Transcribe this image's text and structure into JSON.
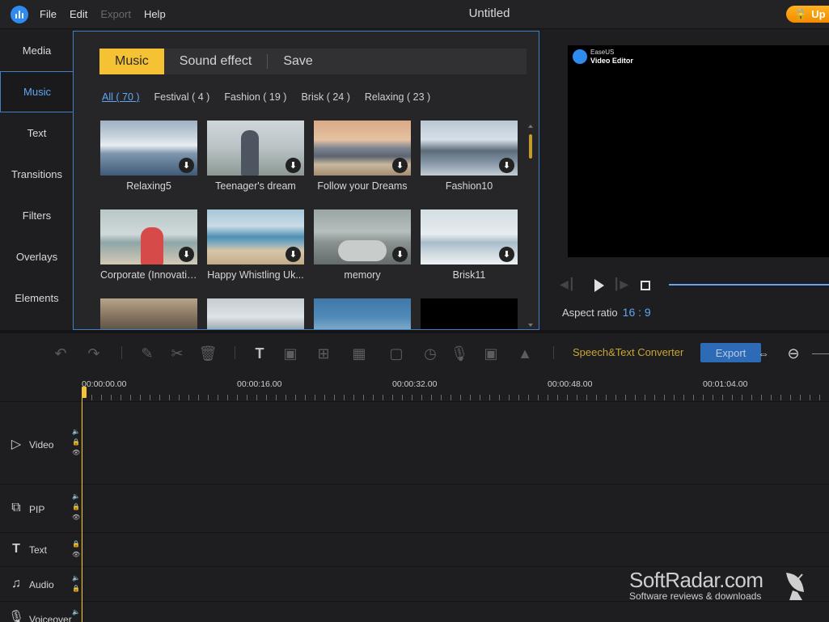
{
  "app": {
    "title": "Untitled",
    "upgrade_label": "Up"
  },
  "menu": [
    {
      "label": "File",
      "disabled": false
    },
    {
      "label": "Edit",
      "disabled": false
    },
    {
      "label": "Export",
      "disabled": true
    },
    {
      "label": "Help",
      "disabled": false
    }
  ],
  "leftnav": [
    {
      "label": "Media",
      "active": false
    },
    {
      "label": "Music",
      "active": true
    },
    {
      "label": "Text",
      "active": false
    },
    {
      "label": "Transitions",
      "active": false
    },
    {
      "label": "Filters",
      "active": false
    },
    {
      "label": "Overlays",
      "active": false
    },
    {
      "label": "Elements",
      "active": false
    }
  ],
  "media_tabs": [
    {
      "label": "Music",
      "active": true
    },
    {
      "label": "Sound effect",
      "active": false
    },
    {
      "label": "Save",
      "active": false
    }
  ],
  "filters": [
    {
      "label": "All ( 70 )",
      "active": true
    },
    {
      "label": "Festival ( 4 )",
      "active": false
    },
    {
      "label": "Fashion ( 19 )",
      "active": false
    },
    {
      "label": "Brisk ( 24 )",
      "active": false
    },
    {
      "label": "Relaxing ( 23 )",
      "active": false
    }
  ],
  "cards": [
    {
      "label": "Relaxing5",
      "scene": "snowy-mountain-lake"
    },
    {
      "label": "Teenager's dream",
      "scene": "girl-on-shore"
    },
    {
      "label": "Follow your Dreams",
      "scene": "sunset-beach"
    },
    {
      "label": "Fashion10",
      "scene": "mountain-range"
    },
    {
      "label": "Corporate (Innovative)",
      "scene": "woman-at-beach"
    },
    {
      "label": "Happy Whistling Uk...",
      "scene": "beach-couple"
    },
    {
      "label": "memory",
      "scene": "sneakers-view"
    },
    {
      "label": "Brisk11",
      "scene": "winter-shore"
    },
    {
      "label": "",
      "scene": "church"
    },
    {
      "label": "",
      "scene": "hazy-sea"
    },
    {
      "label": "",
      "scene": "blue-sea"
    },
    {
      "label": "",
      "scene": "black"
    }
  ],
  "preview": {
    "watermark_small": "EaseUS",
    "watermark_big": "Video Editor",
    "aspect_label": "Aspect ratio",
    "aspect_value": "16 : 9"
  },
  "toolbar": {
    "speech_label": "Speech&Text Converter",
    "export_label": "Export"
  },
  "timeline": {
    "ticks": [
      "00:00:00.00",
      "00:00:16.00",
      "00:00:32.00",
      "00:00:48.00",
      "00:01:04.00"
    ]
  },
  "tracks": [
    {
      "name": "Video",
      "icon": "video-track-icon"
    },
    {
      "name": "PIP",
      "icon": "pip-track-icon"
    },
    {
      "name": "Text",
      "icon": "text-track-icon"
    },
    {
      "name": "Audio",
      "icon": "audio-track-icon"
    },
    {
      "name": "Voiceover",
      "icon": "voiceover-track-icon"
    }
  ],
  "site_watermark": {
    "title": "SoftRadar.com",
    "subtitle": "Software reviews & downloads"
  },
  "colors": {
    "accent_yellow": "#f5c234",
    "accent_blue": "#5fa6f1",
    "upgrade_orange": "#f38a00"
  }
}
